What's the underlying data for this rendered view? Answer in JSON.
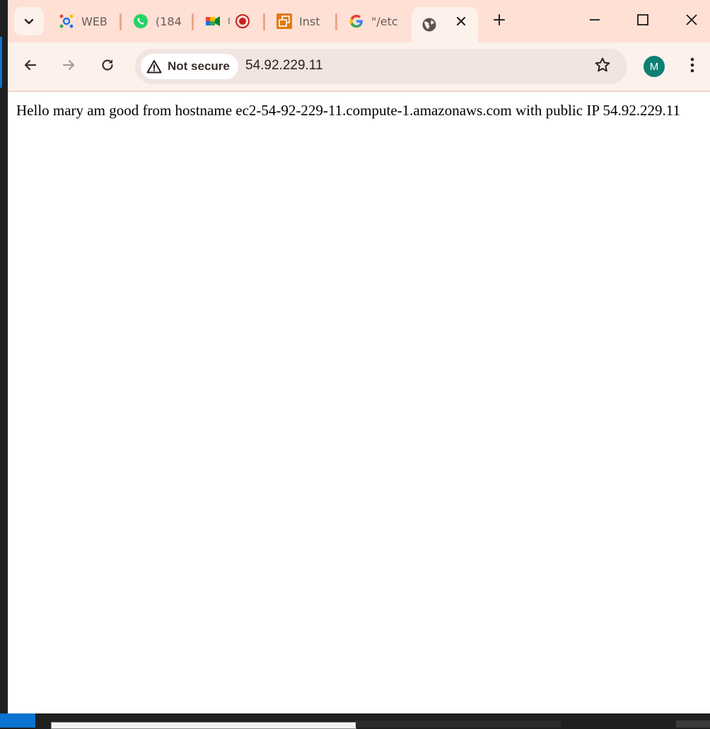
{
  "tabs": [
    {
      "title": "WEB",
      "icon": "helix-icon"
    },
    {
      "title": "(184",
      "icon": "whatsapp-icon"
    },
    {
      "title": "I",
      "icon": "google-meet-icon"
    },
    {
      "title": "Inst",
      "icon": "instances-icon"
    },
    {
      "title": "\"/etc",
      "icon": "google-icon"
    },
    {
      "title": "",
      "icon": "globe-icon",
      "active": true
    }
  ],
  "toolbar": {
    "security_label": "Not secure",
    "url": "54.92.229.11",
    "avatar_letter": "M"
  },
  "page": {
    "text": "Hello mary am good from hostname ec2-54-92-229-11.compute-1.amazonaws.com with public IP 54.92.229.11"
  },
  "colors": {
    "tabstrip_bg": "#ffe0d5",
    "toolbar_bg": "#fdf1ec",
    "avatar_bg": "#0d7f74",
    "tab_separator": "#f0a48a"
  }
}
